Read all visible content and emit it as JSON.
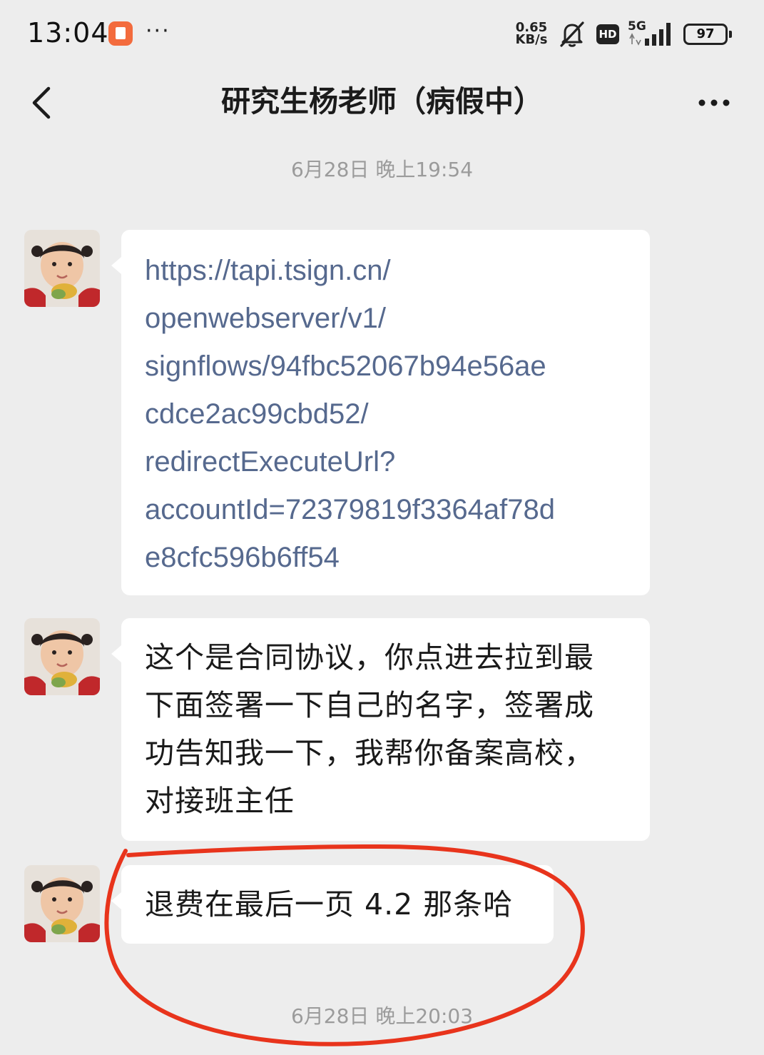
{
  "status_bar": {
    "time": "13:04",
    "app_icon": "notification-app-icon",
    "more": "···",
    "net_speed_value": "0.65",
    "net_speed_unit": "KB/s",
    "hd_label": "HD",
    "network_label": "5G",
    "battery": "97"
  },
  "header": {
    "back_icon": "chevron-left-icon",
    "title": "研究生杨老师（病假中）",
    "more_icon": "more-horizontal-icon"
  },
  "chat": {
    "timestamp_top": "6月28日 晚上19:54",
    "timestamp_bottom": "6月28日 晚上20:03",
    "messages": [
      {
        "sender": "other",
        "type": "link",
        "lines": [
          "https://tapi.tsign.cn/",
          "openwebserver/v1/",
          "signflows/94fbc52067b94e56ae",
          "cdce2ac99cbd52/",
          "redirectExecuteUrl?",
          "accountId=72379819f3364af78d",
          "e8cfc596b6ff54"
        ]
      },
      {
        "sender": "other",
        "type": "text",
        "lines": [
          "这个是合同协议，你点进去拉到最",
          "下面签署一下自己的名字，签署成",
          "功告知我一下，我帮你备案高校，",
          "对接班主任"
        ]
      },
      {
        "sender": "other",
        "type": "text",
        "lines": [
          "退费在最后一页 4.2 那条哈"
        ]
      }
    ]
  },
  "colors": {
    "background": "#ededed",
    "bubble": "#ffffff",
    "link": "#56698e",
    "annotation_circle": "#e8341c"
  }
}
